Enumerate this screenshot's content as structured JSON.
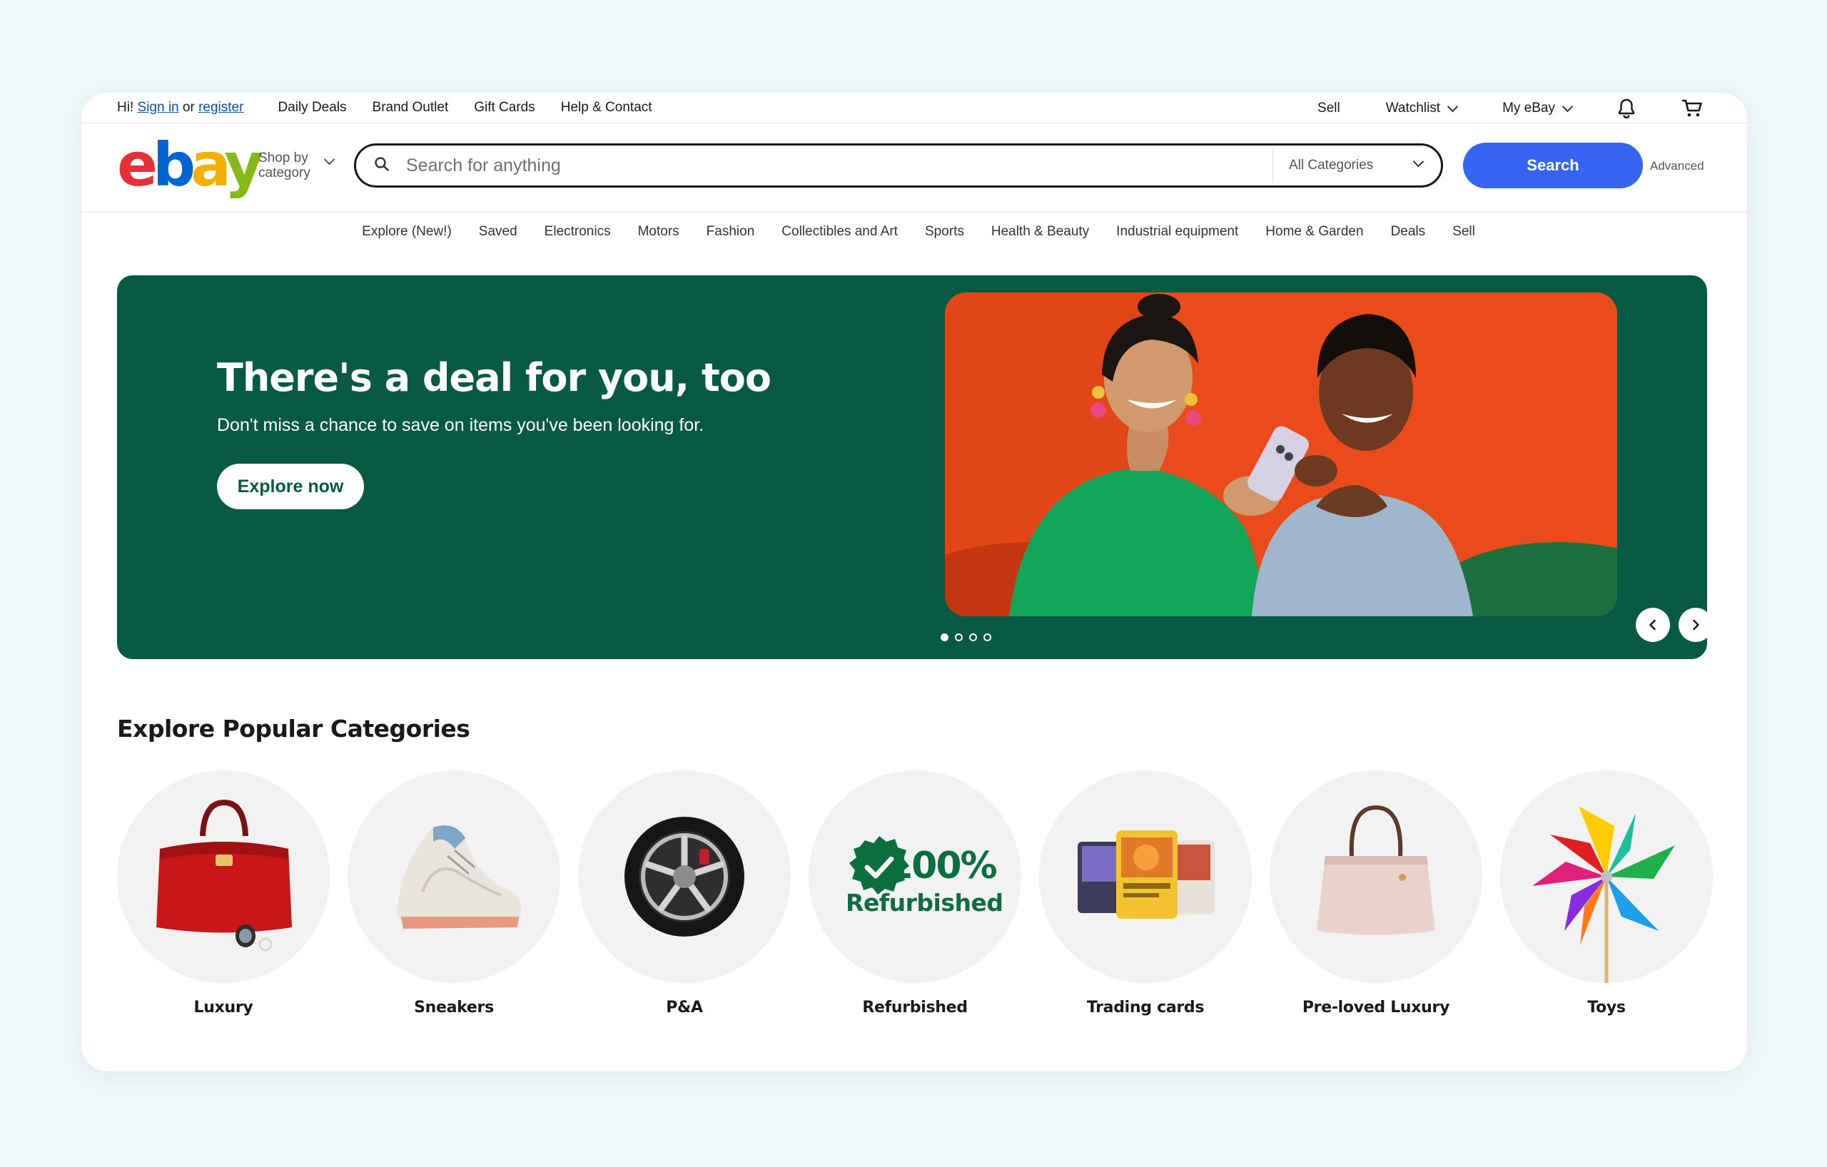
{
  "topbar": {
    "greeting": "Hi!",
    "sign_in": "Sign in",
    "or": "or",
    "register": "register",
    "links": [
      "Daily Deals",
      "Brand Outlet",
      "Gift Cards",
      "Help & Contact"
    ],
    "sell": "Sell",
    "watchlist": "Watchlist",
    "my_ebay": "My eBay"
  },
  "header": {
    "logo": {
      "e": "e",
      "b": "b",
      "a": "a",
      "y": "y"
    },
    "shop_by_line1": "Shop by",
    "shop_by_line2": "category",
    "search_placeholder": "Search for anything",
    "category_select": "All Categories",
    "search_button": "Search",
    "advanced": "Advanced"
  },
  "category_nav": [
    "Explore (New!)",
    "Saved",
    "Electronics",
    "Motors",
    "Fashion",
    "Collectibles and Art",
    "Sports",
    "Health & Beauty",
    "Industrial equipment",
    "Home & Garden",
    "Deals",
    "Sell"
  ],
  "hero": {
    "title": "There's a deal for you, too",
    "subtitle": "Don't miss a chance to save on items you've been looking for.",
    "cta": "Explore now",
    "slides_count": 4,
    "active_slide": 1,
    "background": "#075a42"
  },
  "popular": {
    "title": "Explore Popular Categories",
    "refurbished_badge": {
      "line1": "100%",
      "line2": "Refurbished"
    },
    "categories": [
      "Luxury",
      "Sneakers",
      "P&A",
      "Refurbished",
      "Trading cards",
      "Pre-loved Luxury",
      "Toys"
    ]
  },
  "colors": {
    "brand_blue": "#3665f3",
    "hero_green": "#075a42",
    "link_blue": "#0654ba"
  }
}
